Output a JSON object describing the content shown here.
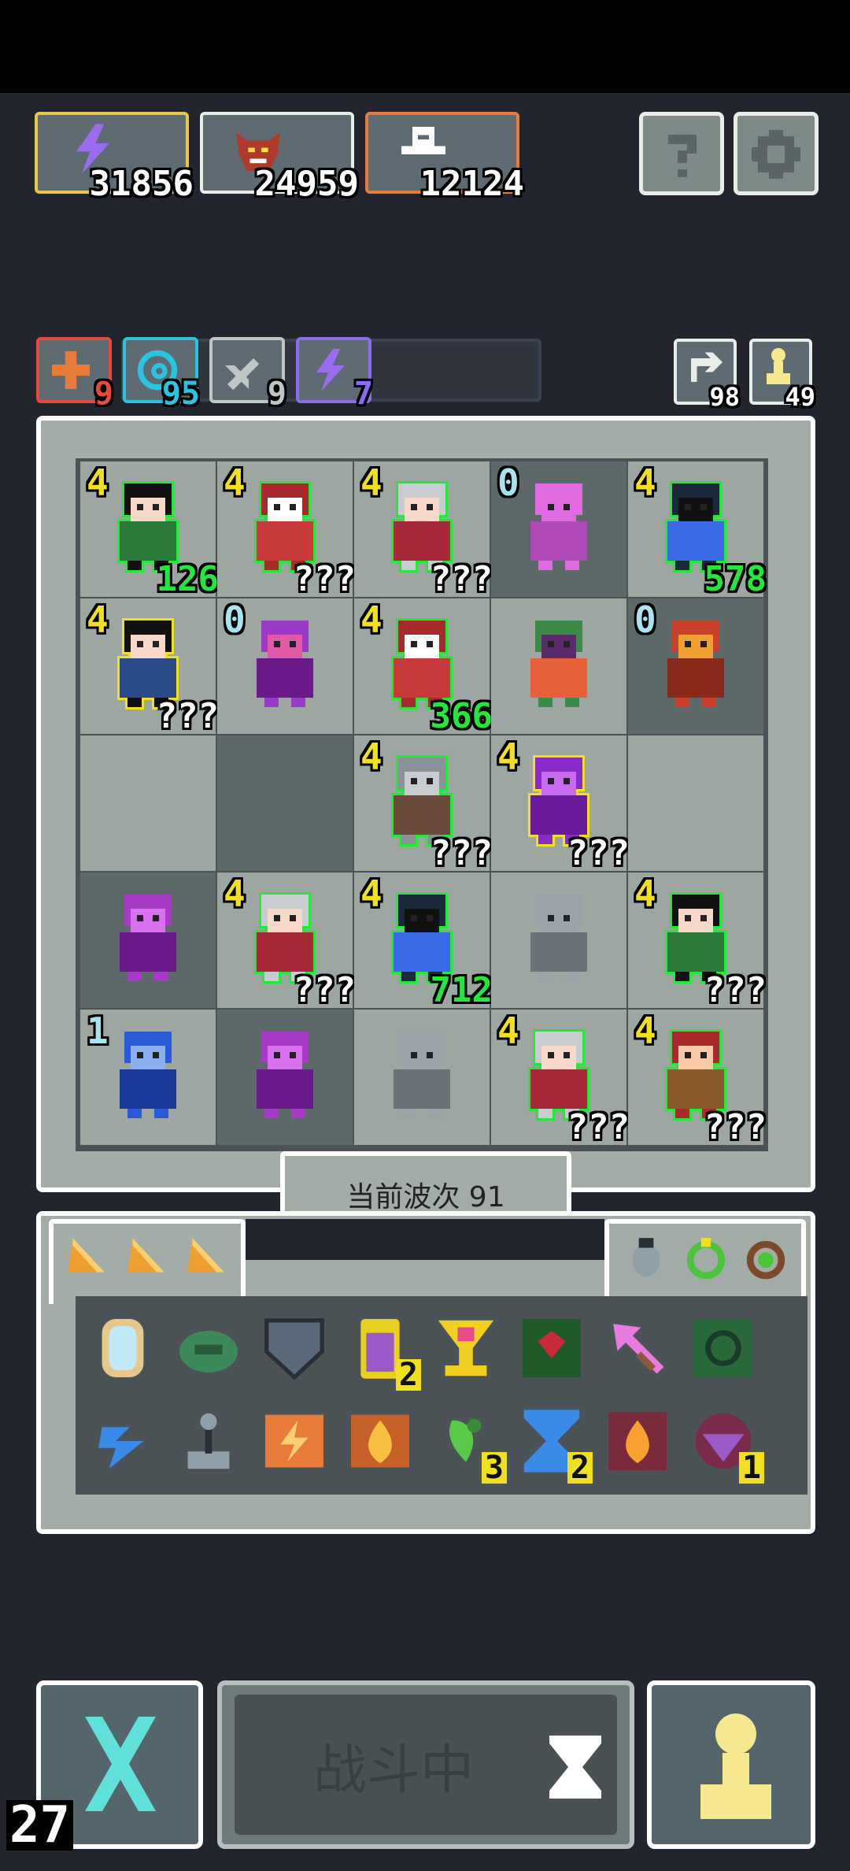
{
  "resources": [
    {
      "value": "31856",
      "icon": "lightning-icon",
      "border": "#e8c64a"
    },
    {
      "value": "24959",
      "icon": "demon-head-icon",
      "border": "#e8ede8"
    },
    {
      "value": "12124",
      "icon": "knight-helmet-icon",
      "border": "#e87a3a"
    }
  ],
  "top_buttons": {
    "help_icon": "question-icon",
    "settings_icon": "gear-icon"
  },
  "buffs": [
    {
      "value": "9",
      "icon": "plus-icon",
      "color": "#e84a3a"
    },
    {
      "value": "95",
      "icon": "spiral-icon",
      "color": "#2ac4e0"
    },
    {
      "value": "9",
      "icon": "sword-icon",
      "color": "#bfc6c6"
    },
    {
      "value": "7",
      "icon": "lightning-icon",
      "color": "#8b6cf0"
    }
  ],
  "counters": [
    {
      "value": "98",
      "icon": "refresh-icon"
    },
    {
      "value": "49",
      "icon": "pawn-icon"
    }
  ],
  "board": {
    "rows": [
      [
        {
          "lvl": "4",
          "num": "126",
          "numColor": "#22e83a",
          "unit": "witch-unit",
          "frame": "#22e83a"
        },
        {
          "lvl": "4",
          "num": "???",
          "numColor": "#ffffff",
          "unit": "red-mage-unit",
          "frame": "#22e83a"
        },
        {
          "lvl": "4",
          "num": "???",
          "numColor": "#ffffff",
          "unit": "silver-girl-unit",
          "frame": "#22e83a"
        },
        {
          "lvl": "0",
          "num": "",
          "numColor": "#ffffff",
          "unit": "pink-imp-unit",
          "frame": "",
          "lvlColor": "#a8e4f0"
        },
        {
          "lvl": "4",
          "num": "578",
          "numColor": "#22e83a",
          "unit": "hooded-blue-unit",
          "frame": "#22e83a"
        }
      ],
      [
        {
          "lvl": "4",
          "num": "???",
          "numColor": "#ffffff",
          "unit": "staff-witch-unit",
          "frame": "#f0e020"
        },
        {
          "lvl": "0",
          "num": "",
          "numColor": "#ffffff",
          "unit": "purple-dragon-unit",
          "frame": "",
          "lvlColor": "#a8e4f0"
        },
        {
          "lvl": "4",
          "num": "366",
          "numColor": "#22e83a",
          "unit": "red-mage-unit",
          "frame": "#22e83a"
        },
        {
          "lvl": "",
          "num": "",
          "numColor": "#ffffff",
          "unit": "crystal-plant-unit",
          "frame": ""
        },
        {
          "lvl": "0",
          "num": "",
          "numColor": "#ffffff",
          "unit": "red-dragon-unit",
          "frame": "",
          "lvlColor": "#a8e4f0"
        }
      ],
      [
        {
          "lvl": "",
          "num": "",
          "numColor": "#ffffff",
          "unit": "",
          "frame": ""
        },
        {
          "lvl": "",
          "num": "",
          "numColor": "#ffffff",
          "unit": "",
          "frame": ""
        },
        {
          "lvl": "4",
          "num": "???",
          "numColor": "#ffffff",
          "unit": "armored-knight-unit",
          "frame": "#22e83a"
        },
        {
          "lvl": "4",
          "num": "???",
          "numColor": "#ffffff",
          "unit": "purple-knight-unit",
          "frame": "#f0e020"
        },
        {
          "lvl": "",
          "num": "",
          "numColor": "#ffffff",
          "unit": "",
          "frame": ""
        }
      ],
      [
        {
          "lvl": "",
          "num": "",
          "numColor": "#ffffff",
          "unit": "purple-golem-unit",
          "frame": ""
        },
        {
          "lvl": "4",
          "num": "???",
          "numColor": "#ffffff",
          "unit": "silver-girl-unit",
          "frame": "#22e83a"
        },
        {
          "lvl": "4",
          "num": "712",
          "numColor": "#22e83a",
          "unit": "hooded-blue-unit",
          "frame": "#22e83a"
        },
        {
          "lvl": "",
          "num": "",
          "numColor": "#ffffff",
          "unit": "gray-demon-unit",
          "frame": ""
        },
        {
          "lvl": "4",
          "num": "???",
          "numColor": "#ffffff",
          "unit": "witch-unit",
          "frame": "#22e83a"
        }
      ],
      [
        {
          "lvl": "1",
          "num": "",
          "numColor": "#ffffff",
          "unit": "blue-rune-unit",
          "frame": "",
          "lvlColor": "#a8e4f0"
        },
        {
          "lvl": "",
          "num": "",
          "numColor": "#ffffff",
          "unit": "purple-golem-unit",
          "frame": ""
        },
        {
          "lvl": "",
          "num": "",
          "numColor": "#ffffff",
          "unit": "gray-demon-unit",
          "frame": ""
        },
        {
          "lvl": "4",
          "num": "???",
          "numColor": "#ffffff",
          "unit": "silver-girl-unit",
          "frame": "#22e83a"
        },
        {
          "lvl": "4",
          "num": "???",
          "numColor": "#ffffff",
          "unit": "lumberjack-unit",
          "frame": "#22e83a"
        }
      ]
    ]
  },
  "wave": {
    "label": "当前波次 91"
  },
  "inventory": {
    "tabs": [
      "cheese-icon",
      "cheese-icon",
      "cheese-icon"
    ],
    "right_icons": [
      "beetle-icon",
      "green-ring-icon",
      "brown-ring-icon"
    ],
    "items": [
      {
        "icon": "mirror-icon",
        "count": ""
      },
      {
        "icon": "turtle-shell-icon",
        "count": ""
      },
      {
        "icon": "shield-icon",
        "count": ""
      },
      {
        "icon": "potion-jar-icon",
        "count": "2"
      },
      {
        "icon": "golden-chalice-icon",
        "count": ""
      },
      {
        "icon": "green-tome-icon",
        "count": ""
      },
      {
        "icon": "arrow-icon",
        "count": ""
      },
      {
        "icon": "green-rune-icon",
        "count": ""
      },
      {
        "icon": "blue-claw-icon",
        "count": ""
      },
      {
        "icon": "joystick-icon",
        "count": ""
      },
      {
        "icon": "thunder-scroll-icon",
        "count": ""
      },
      {
        "icon": "fire-scroll-icon",
        "count": ""
      },
      {
        "icon": "green-herb-icon",
        "count": "3"
      },
      {
        "icon": "hourglass-icon",
        "count": "2"
      },
      {
        "icon": "fire-book-icon",
        "count": ""
      },
      {
        "icon": "purple-amulet-icon",
        "count": "1"
      }
    ]
  },
  "bottom": {
    "cancel_icon": "cross-icon",
    "fight_label": "战斗中",
    "fight_icon": "hourglass-icon",
    "pawn_icon": "pawn-icon",
    "corner_number": "27"
  }
}
